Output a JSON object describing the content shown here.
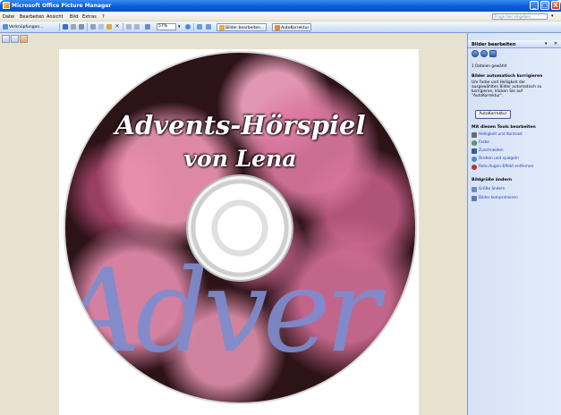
{
  "window": {
    "title": "Microsoft Office Picture Manager",
    "controls": {
      "minimize": "_",
      "maximize": "□",
      "close": "X"
    }
  },
  "menu": {
    "items": [
      "Datei",
      "Bearbeiten",
      "Ansicht",
      "Bild",
      "Extras",
      "?"
    ],
    "help_placeholder": "Frage hier eingeben"
  },
  "toolbar": {
    "shortcuts_label": "Verknüpfungen...",
    "zoom_value": "57%",
    "edit_images_label": "Bilder bearbeiten...",
    "autocorrect_label": "AutoKorrektur"
  },
  "disc": {
    "line1": "Advents-Hörspiel",
    "line2": "von Lena",
    "big_text": "Adver"
  },
  "pane": {
    "title": "Bilder bearbeiten",
    "selected_count": "1 Dateien gewählt",
    "auto_heading": "Bilder automatisch korrigieren",
    "auto_desc": [
      "Um Farbe und Helligkeit der",
      "ausgewählten Bilder automatisch zu",
      "korrigieren, klicken Sie auf",
      "\"AutoKorrektur\"."
    ],
    "auto_button": "AutoKorrektur",
    "tools_heading": "Mit diesen Tools bearbeiten",
    "tools": [
      {
        "label": "Helligkeit und Kontrast",
        "icon": "brightness-icon"
      },
      {
        "label": "Farbe",
        "icon": "color-icon"
      },
      {
        "label": "Zuschneiden",
        "icon": "crop-icon"
      },
      {
        "label": "Drehen und spiegeln",
        "icon": "rotate-icon"
      },
      {
        "label": "Rote-Augen-Effekt entfernen",
        "icon": "red-eye-icon"
      }
    ],
    "size_heading": "Bildgröße ändern",
    "size_tools": [
      {
        "label": "Größe ändern",
        "icon": "resize-icon"
      },
      {
        "label": "Bilder komprimieren",
        "icon": "compress-icon"
      }
    ]
  }
}
